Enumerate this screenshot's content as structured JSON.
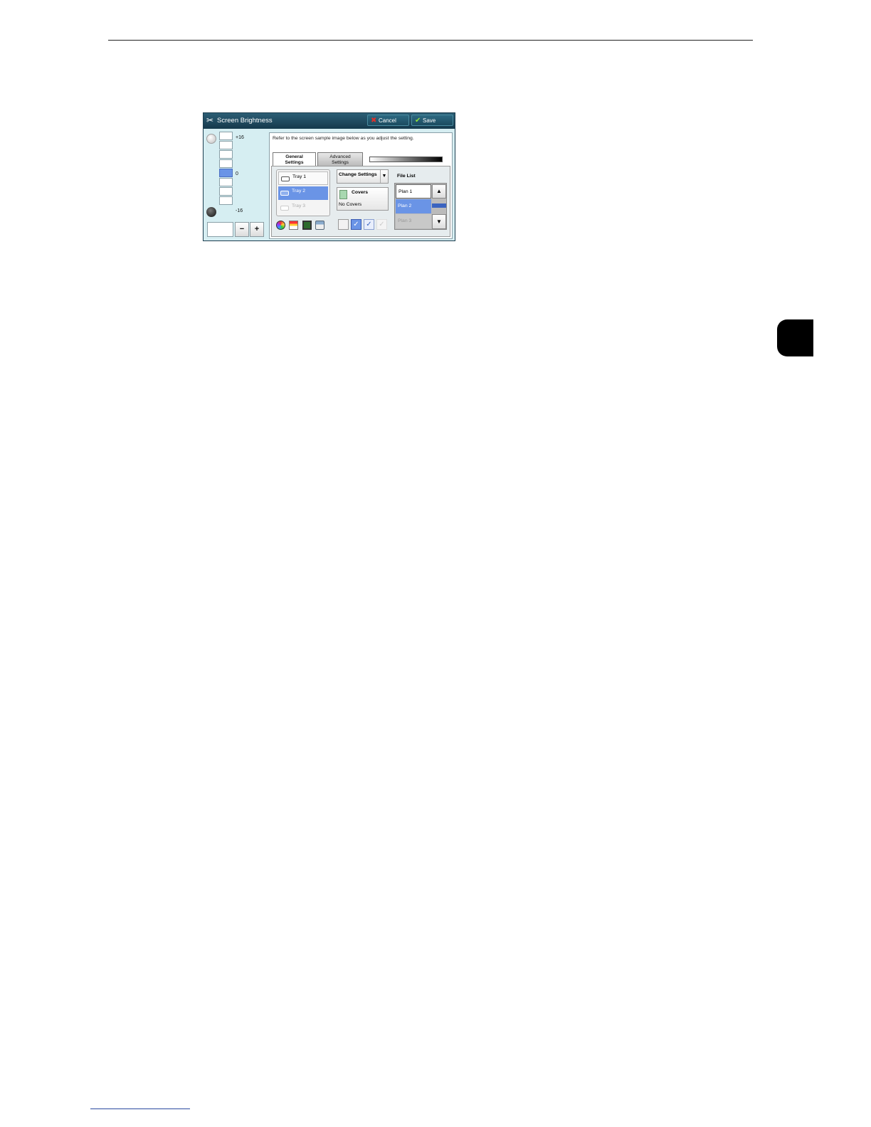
{
  "window": {
    "title": "Screen Brightness",
    "cancel_label": "Cancel",
    "save_label": "Save"
  },
  "slider": {
    "max_label": "+16",
    "mid_label": "0",
    "min_label": "-16",
    "value": 0,
    "minus_label": "−",
    "plus_label": "+"
  },
  "sample": {
    "instruction": "Refer to the screen sample image below as you adjust the setting.",
    "tabs": [
      {
        "label_line1": "General",
        "label_line2": "Settings"
      },
      {
        "label_line1": "Advanced",
        "label_line2": "Settings"
      }
    ],
    "trays": [
      {
        "label": "Tray 1"
      },
      {
        "label": "Tray 2"
      },
      {
        "label": "Tray 3"
      }
    ],
    "change_settings_label": "Change Settings",
    "covers": {
      "label": "Covers",
      "value": "No Covers"
    },
    "file_list": {
      "label": "File List",
      "items": [
        "Plan 1",
        "Plan 2",
        "Plan 3"
      ]
    }
  },
  "colors": {
    "titlebar": "#1b4a5f",
    "selected": "#6a94e6",
    "background": "#d6eef2"
  }
}
